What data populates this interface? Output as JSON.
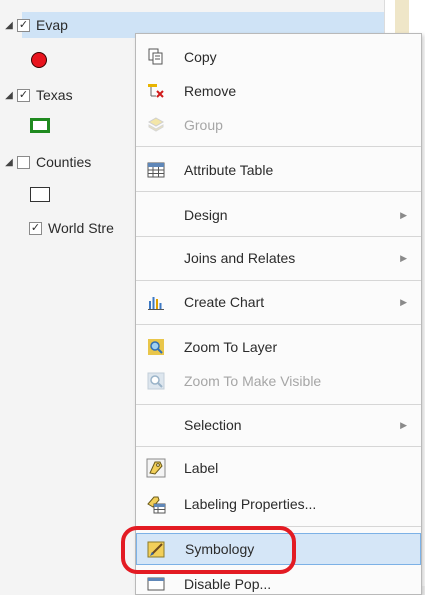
{
  "contents_pane": {
    "layers": [
      {
        "name": "Evap",
        "checked": true,
        "symbol": "red-circle-marker"
      },
      {
        "name": "Texas",
        "checked": true,
        "symbol": "green-outline-polygon"
      },
      {
        "name": "Counties",
        "checked": false,
        "symbol": "black-outline-polygon"
      },
      {
        "name": "World Stre",
        "checked": true
      }
    ]
  },
  "context_menu": {
    "items": [
      {
        "label": "Copy",
        "icon": "copy-icon"
      },
      {
        "label": "Remove",
        "icon": "remove-icon"
      },
      {
        "label": "Group",
        "icon": "group-icon",
        "disabled": true
      },
      {
        "label": "Attribute Table",
        "icon": "table-icon"
      },
      {
        "label": "Design",
        "submenu": true
      },
      {
        "label": "Joins and Relates",
        "submenu": true
      },
      {
        "label": "Create Chart",
        "icon": "chart-icon",
        "submenu": true
      },
      {
        "label": "Zoom To Layer",
        "icon": "zoom-icon"
      },
      {
        "label": "Zoom To Make Visible",
        "icon": "zoom-visible-icon",
        "disabled": true
      },
      {
        "label": "Selection",
        "submenu": true
      },
      {
        "label": "Label",
        "icon": "label-icon"
      },
      {
        "label": "Labeling Properties...",
        "icon": "labeling-properties-icon"
      },
      {
        "label": "Symbology",
        "icon": "symbology-icon",
        "selected": true
      },
      {
        "label": "Disable Pop...",
        "partial": true
      }
    ]
  },
  "colors": {
    "highlight": "#cfe3f6",
    "selected_item": "#d5e6f7",
    "annotation_circle": "#e31b23",
    "evap_symbol": "#e8141e",
    "texas_symbol": "#1f8a1f"
  }
}
